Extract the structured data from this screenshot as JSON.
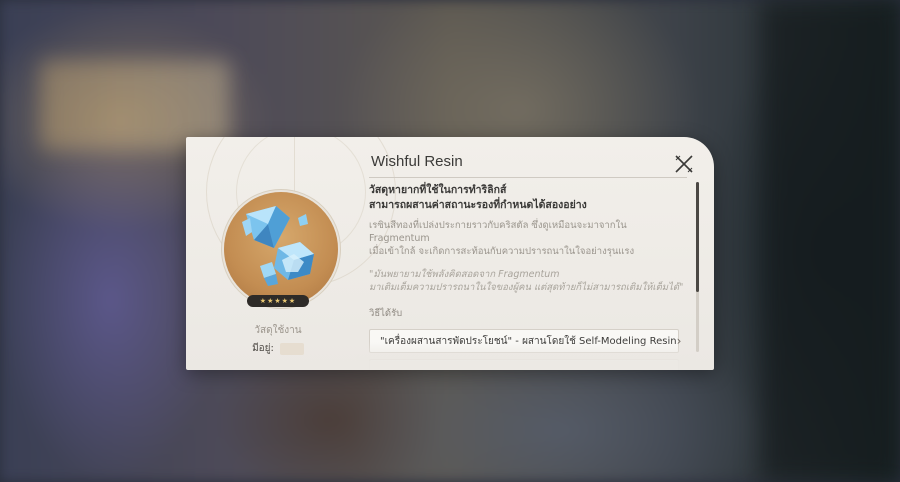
{
  "dialog": {
    "title": "Wishful Resin",
    "subtitle_line1": "วัสดุหายากที่ใช้ในการทำริลิกส์",
    "subtitle_line2": "สามารถผสานค่าสถานะรองที่กำหนดได้สองอย่าง",
    "description_line1": "เรซินสีทองที่เปล่งประกายราวกับคริสตัล ซึ่งดูเหมือนจะมาจากใน Fragmentum",
    "description_line2": "เมื่อเข้าใกล้ จะเกิดการสะท้อนกับความปรารถนาในใจอย่างรุนแรง",
    "quote_line1": "\"มันพยายามใช้พลังคิดสอดจาก Fragmentum",
    "quote_line2": "มาเติมเต็มความปรารถนาในใจของผู้คน แต่สุดท้ายก็ไม่สามารถเติมให้เต็มได้\"",
    "sources_label": "วิธีได้รับ",
    "source_1_label": "\"เครื่องผสานสารพัดประโยชน์\" - ผสานโดยใช้ Self-Modeling Resin",
    "source_1_chevron": "›",
    "close_icon": "close-icon"
  },
  "item": {
    "type_label": "วัสดุใช้งาน",
    "owned_label": "มีอยู่:",
    "rarity_stars": "★★★★★",
    "icon": "resin-crystal-icon"
  },
  "colors": {
    "dialog_bg": "#f2efea",
    "item_circle": "#c38d52",
    "star": "#e9c772",
    "text_primary": "#3b3a38",
    "text_muted": "#9a958d"
  }
}
